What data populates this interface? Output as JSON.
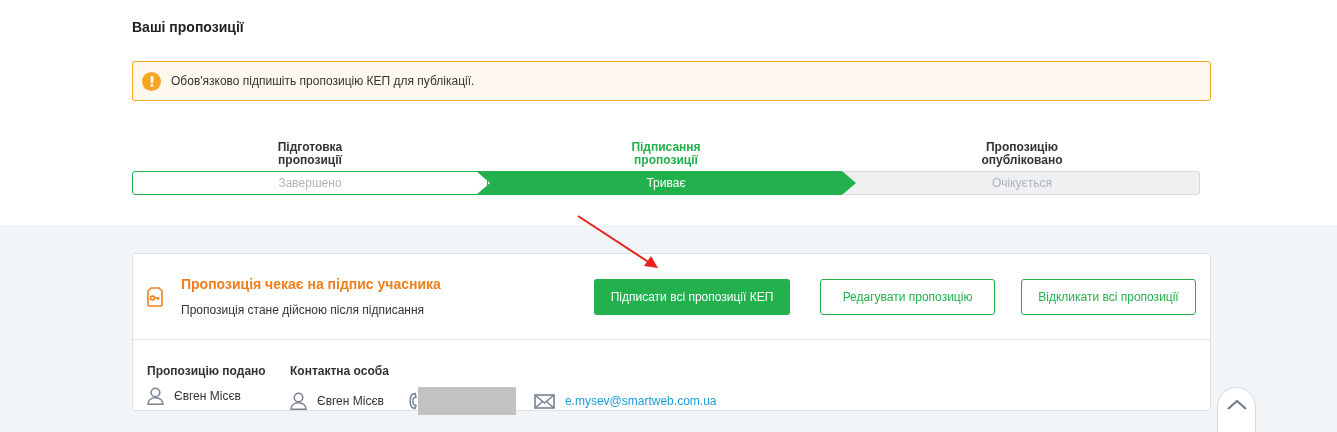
{
  "page_title": "Ваші пропозиції",
  "alert": {
    "text": "Обов'язково підпишіть пропозицію КЕП для публікації."
  },
  "steps": [
    {
      "title_lines": [
        "Підготовка",
        "пропозиції"
      ],
      "status": "Завершено",
      "kind": "done"
    },
    {
      "title_lines": [
        "Підписання",
        "пропозиції"
      ],
      "status": "Триває",
      "kind": "active"
    },
    {
      "title_lines": [
        "Пропозицію",
        "опубліковано"
      ],
      "status": "Очікується",
      "kind": "pending"
    }
  ],
  "status_card": {
    "title": "Пропозиція чекає на підпис учасника",
    "subtitle": "Пропозиція стане дійсною після підписання",
    "buttons": [
      {
        "label": "Підписати всі пропозиції КЕП",
        "kind": "primary"
      },
      {
        "label": "Редагувати пропозицію",
        "kind": "outline"
      },
      {
        "label": "Відкликати всі пропозиції",
        "kind": "outline"
      }
    ]
  },
  "submitted_by": {
    "label": "Пропозицію подано",
    "name": "Євген Місєв"
  },
  "contact": {
    "label": "Контактна особа",
    "name": "Євген Місєв",
    "email": "e.mysev@smartweb.com.ua"
  }
}
